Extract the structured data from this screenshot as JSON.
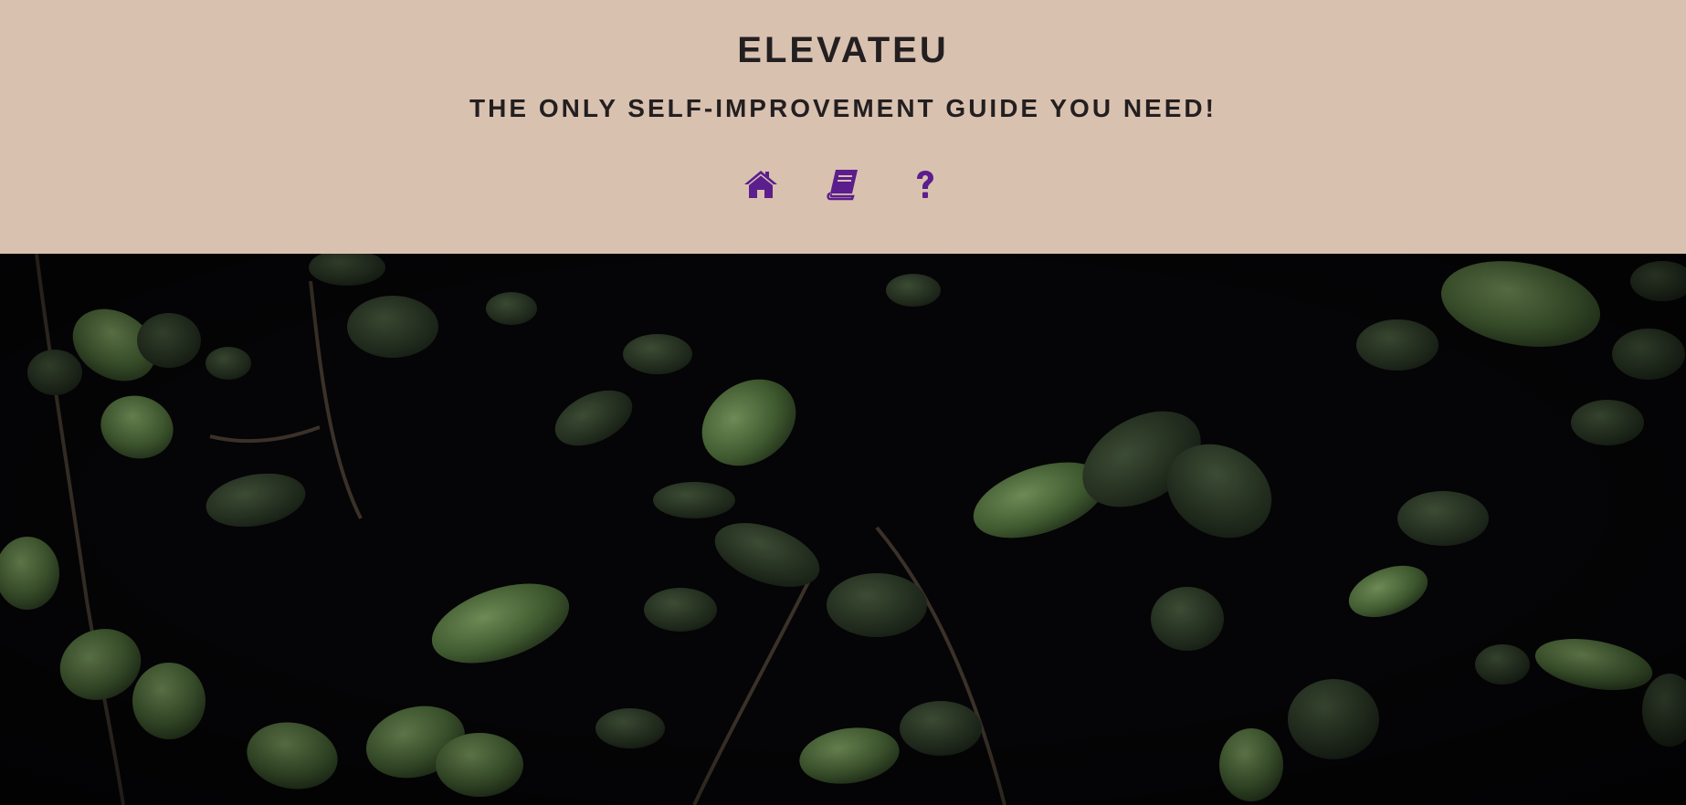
{
  "header": {
    "title": "ELEVATEU",
    "tagline": "THE ONLY SELF-IMPROVEMENT GUIDE YOU NEED!"
  },
  "nav": {
    "items": [
      {
        "icon": "home-icon"
      },
      {
        "icon": "book-icon"
      },
      {
        "icon": "question-icon"
      }
    ]
  },
  "hero": {
    "image": "dark-leaves-background"
  },
  "colors": {
    "header_bg": "#d9c1b0",
    "text": "#231f20",
    "icon_accent": "#5b1e8c",
    "hero_bg": "#050406",
    "leaf": "#4e6a3c"
  }
}
